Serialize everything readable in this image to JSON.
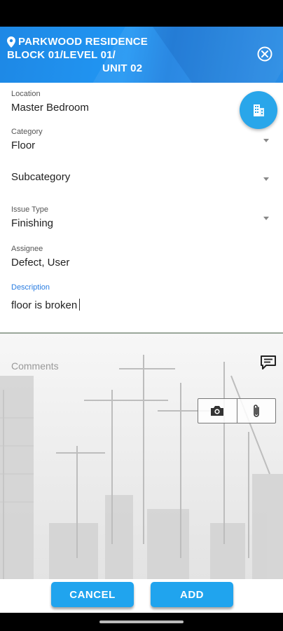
{
  "header": {
    "project": "PARKWOOD RESIDENCE",
    "path_line": "BLOCK 01/LEVEL 01/",
    "unit": "UNIT 02"
  },
  "form": {
    "location": {
      "label": "Location",
      "value": "Master Bedroom"
    },
    "category": {
      "label": "Category",
      "value": "Floor"
    },
    "subcategory": {
      "value": "Subcategory"
    },
    "issue_type": {
      "label": "Issue Type",
      "value": "Finishing"
    },
    "assignee": {
      "label": "Assignee",
      "value": "Defect, User"
    },
    "description": {
      "label": "Description",
      "value": "floor is broken"
    }
  },
  "comments": {
    "placeholder": "Comments"
  },
  "actions": {
    "cancel_label": "CANCEL",
    "add_label": "ADD"
  },
  "colors": {
    "accent": "#20a4ee",
    "header": "#1e88e5",
    "fab": "#29a6ea",
    "focus_label": "#2a7de1"
  },
  "icons": [
    "location-pin-icon",
    "close-circle-icon",
    "building-icon",
    "chat-icon",
    "camera-icon",
    "paperclip-icon"
  ]
}
